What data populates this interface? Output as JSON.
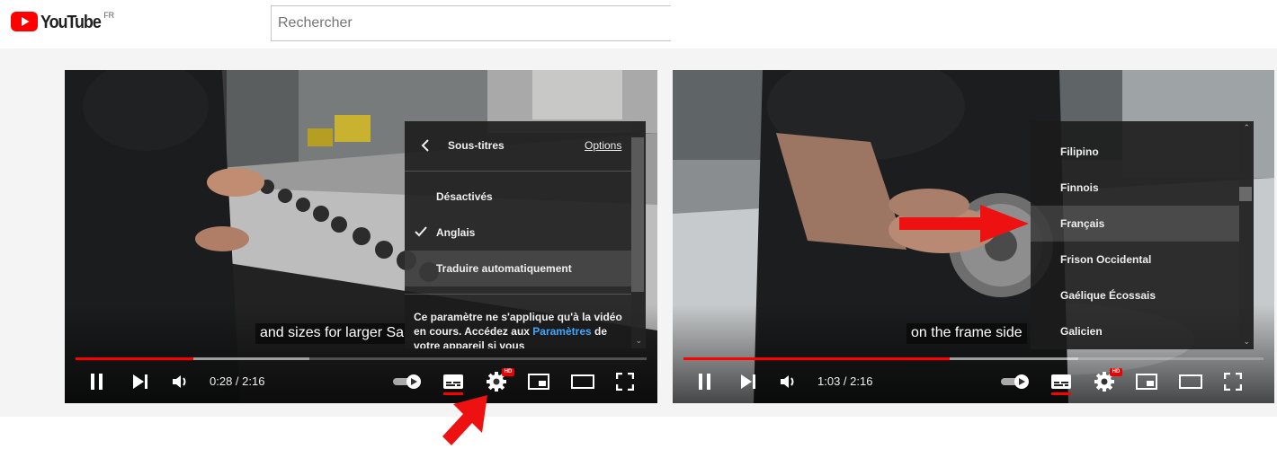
{
  "header": {
    "logo_text": "YouTube",
    "country_code": "FR",
    "search_placeholder": "Rechercher"
  },
  "colors": {
    "brand_red": "#ff0000",
    "progress_red": "#ff0000",
    "link_blue": "#3ea6ff",
    "annotation_arrow": "#ee1111"
  },
  "player_left": {
    "caption": "and sizes for larger Sa",
    "time": "0:28 / 2:16",
    "progress_played": 0.206,
    "progress_buffered": 0.41,
    "hd_badge": "HD",
    "submenu": {
      "title": "Sous-titres",
      "options_link": "Options",
      "items": [
        {
          "label": "Désactivés",
          "selected": false,
          "highlighted": false
        },
        {
          "label": "Anglais",
          "selected": true,
          "highlighted": false
        },
        {
          "label": "Traduire automatiquement",
          "selected": false,
          "highlighted": true
        }
      ],
      "note_prefix": "Ce paramètre ne s'applique qu'à la vidéo en cours. Accédez aux ",
      "note_link": "Paramètres",
      "note_suffix": " de votre appareil si vous"
    }
  },
  "player_right": {
    "caption": "on the frame side",
    "time": "1:03 / 2:16",
    "progress_played": 0.459,
    "progress_buffered": 0.68,
    "hd_badge": "HD",
    "languages": [
      {
        "label": "Filipino",
        "highlighted": false
      },
      {
        "label": "Finnois",
        "highlighted": false
      },
      {
        "label": "Français",
        "highlighted": true
      },
      {
        "label": "Frison Occidental",
        "highlighted": false
      },
      {
        "label": "Gaélique Écossais",
        "highlighted": false
      },
      {
        "label": "Galicien",
        "highlighted": false
      }
    ]
  }
}
